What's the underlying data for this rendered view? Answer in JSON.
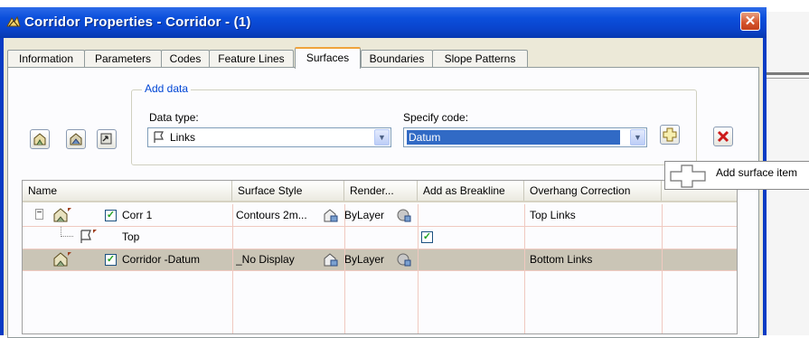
{
  "window": {
    "title": "Corridor Properties - Corridor - (1)",
    "close_glyph": "✕"
  },
  "tabs": [
    {
      "label": "Information",
      "active": false
    },
    {
      "label": "Parameters",
      "active": false
    },
    {
      "label": "Codes",
      "active": false
    },
    {
      "label": "Feature Lines",
      "active": false
    },
    {
      "label": "Surfaces",
      "active": true
    },
    {
      "label": "Boundaries",
      "active": false
    },
    {
      "label": "Slope Patterns",
      "active": false
    }
  ],
  "add_data": {
    "group_title": "Add data",
    "data_type_label": "Data type:",
    "data_type_value": "Links",
    "specify_code_label": "Specify code:",
    "specify_code_value": "Datum"
  },
  "toolbar_icons": [
    "create-surface-icon",
    "create-surface-from-corridor-icon",
    "surface-boundary-icon"
  ],
  "table": {
    "columns": [
      "Name",
      "Surface Style",
      "Render...",
      "Add as Breakline",
      "Overhang Correction"
    ],
    "rows": [
      {
        "name": "Corr 1",
        "style": "Contours 2m...",
        "render": "ByLayer",
        "breakline": "",
        "overhang": "Top Links",
        "checked": true,
        "level": 0,
        "selected": false
      },
      {
        "name": "Top",
        "style": "",
        "render": "",
        "breakline": "checked",
        "overhang": "",
        "checked": false,
        "level": 1,
        "selected": false
      },
      {
        "name": "Corridor -Datum",
        "style": "_No Display",
        "render": "ByLayer",
        "breakline": "",
        "overhang": "Bottom Links",
        "checked": true,
        "level": 0,
        "selected": true
      }
    ]
  },
  "tooltip": {
    "text": "Add surface item"
  },
  "colors": {
    "title_bar": "#0a44cc",
    "dialog_bg": "#ece9d8",
    "selected_row": "#cac5b6",
    "close_button": "#d4522a",
    "active_tab_accent": "#f0a33c"
  }
}
